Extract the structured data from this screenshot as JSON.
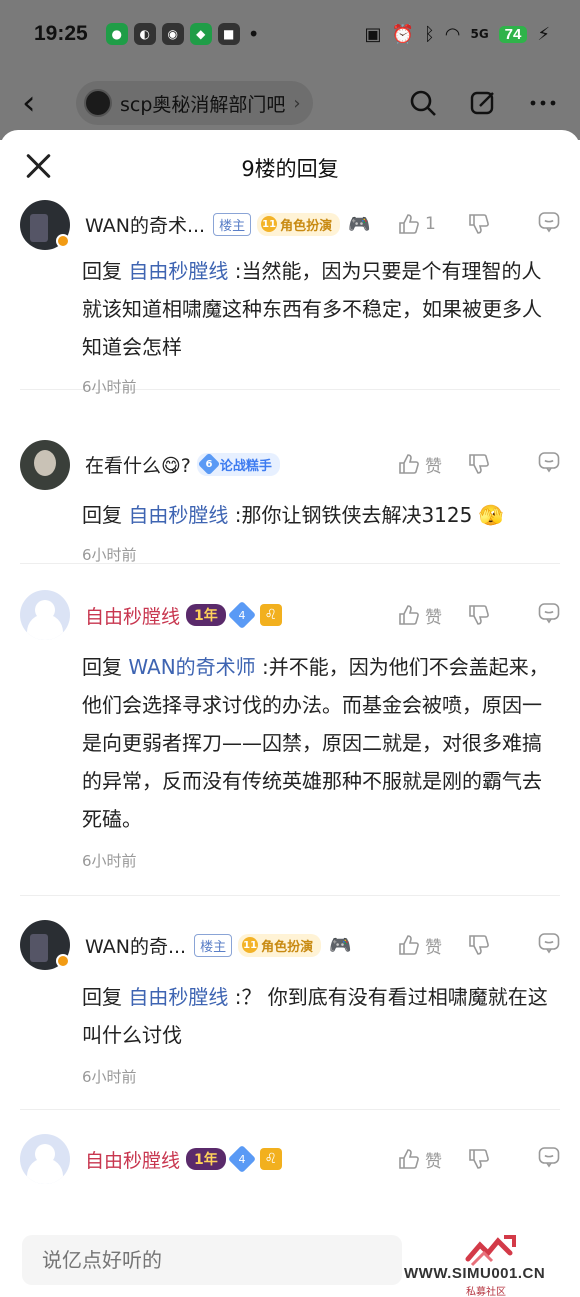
{
  "status_bar": {
    "time": "19:25",
    "network": "5G",
    "battery": "74"
  },
  "topnav": {
    "forum_name": "scp奥秘消解部门吧"
  },
  "sheet": {
    "title": "9楼的回复"
  },
  "replies": [
    {
      "username": "WAN的奇术...",
      "owner_tag": "楼主",
      "role_badge": "角色扮演",
      "role_level": "11",
      "like_label": "1",
      "reply_prefix": "回复 ",
      "mention": "自由秒膛线",
      "text": " :当然能，因为只要是个有理智的人就该知道相啸魔这种东西有多不稳定，如果被更多人知道会怎样",
      "time": "6小时前"
    },
    {
      "username": "在看什么😋?",
      "role_badge": "论战糕手",
      "role_level": "6",
      "like_label": "赞",
      "reply_prefix": "回复 ",
      "mention": "自由秒膛线",
      "text": " :那你让钢铁侠去解决3125 🫣",
      "time": "6小时前"
    },
    {
      "username": "自由秒膛线",
      "year_badge": "1年",
      "level": "4",
      "like_label": "赞",
      "reply_prefix": "回复 ",
      "mention": "WAN的奇术师",
      "text": " :并不能，因为他们不会盖起来，他们会选择寻求讨伐的办法。而基金会被喷，原因一是向更弱者挥刀——囚禁，原因二就是，对很多难搞的异常，反而没有传统英雄那种不服就是刚的霸气去死磕。",
      "time": "6小时前"
    },
    {
      "username": "WAN的奇...",
      "owner_tag": "楼主",
      "role_badge": "角色扮演",
      "role_level": "11",
      "like_label": "赞",
      "reply_prefix": "回复 ",
      "mention": "自由秒膛线",
      "text": " :？ 你到底有没有看过相啸魔就在这叫什么讨伐",
      "time": "6小时前"
    },
    {
      "username": "自由秒膛线",
      "year_badge": "1年",
      "level": "4",
      "like_label": "赞"
    }
  ],
  "input": {
    "placeholder": "说亿点好听的"
  },
  "watermark": {
    "site": "WWW.SIMU001.CN",
    "sub": "私募社区"
  },
  "colors": {
    "mention": "#3e64b2",
    "pink_name": "#c8364f",
    "meta_gray": "#999999"
  }
}
